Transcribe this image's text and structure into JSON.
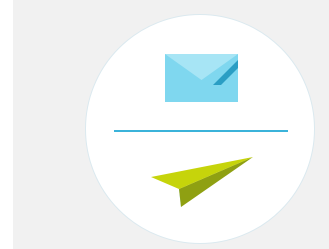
{
  "icons": {
    "top": "envelope-icon",
    "bottom": "paper-plane-icon"
  },
  "colors": {
    "panel_background": "#f1f1f1",
    "badge_background": "#ffffff",
    "envelope_body": "#7fd7ef",
    "envelope_flap": "#a7e5f5",
    "envelope_shadow": "#2a9ec4",
    "divider": "#3bb3da",
    "plane_top": "#c6d40b",
    "plane_bottom": "#8fa012",
    "plane_tail": "#7fd7ef"
  }
}
